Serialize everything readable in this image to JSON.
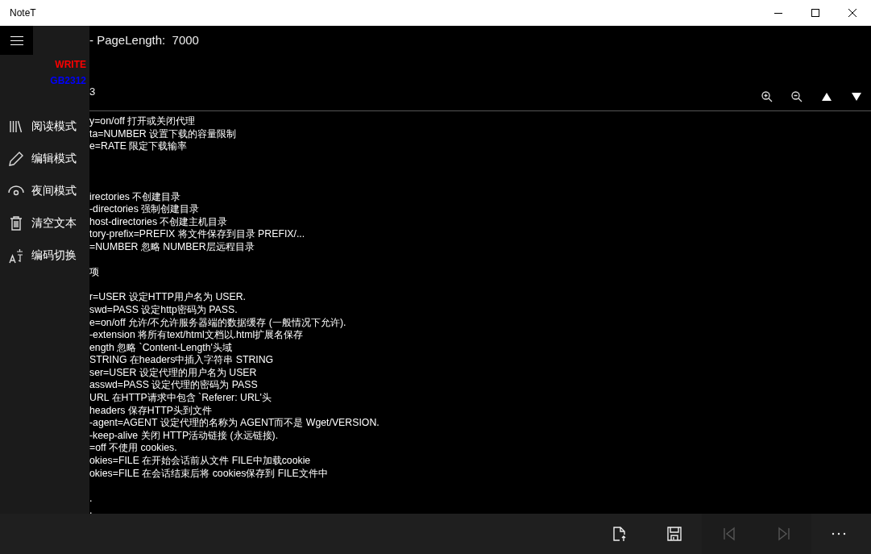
{
  "window": {
    "title": "NoteT"
  },
  "header": {
    "page_info": "- PageLength:  7000",
    "line_fragment": "3"
  },
  "sidebar": {
    "mode": "WRITE",
    "encoding": "GB2312",
    "items": [
      {
        "label": "阅读模式"
      },
      {
        "label": "编辑模式"
      },
      {
        "label": "夜间模式"
      },
      {
        "label": "清空文本"
      },
      {
        "label": "编码切换"
      }
    ]
  },
  "lines": [
    {
      "kind": "text",
      "text": "y=on/off 打开或关闭代理"
    },
    {
      "kind": "text",
      "text": "ta=NUMBER 设置下载的容量限制"
    },
    {
      "kind": "text",
      "text": "e=RATE 限定下载输率"
    },
    {
      "kind": "blank"
    },
    {
      "kind": "blank"
    },
    {
      "kind": "blank"
    },
    {
      "kind": "text",
      "text": "irectories 不创建目录"
    },
    {
      "kind": "text",
      "text": "-directories 强制创建目录"
    },
    {
      "kind": "text",
      "text": "host-directories 不创建主机目录"
    },
    {
      "kind": "text",
      "text": "tory-prefix=PREFIX 将文件保存到目录 PREFIX/..."
    },
    {
      "kind": "text",
      "text": "=NUMBER 忽略 NUMBER层远程目录"
    },
    {
      "kind": "blank"
    },
    {
      "kind": "text",
      "text": "项"
    },
    {
      "kind": "blank"
    },
    {
      "kind": "text",
      "text": "r=USER 设定HTTP用户名为 USER."
    },
    {
      "kind": "text",
      "text": "swd=PASS 设定http密码为 PASS."
    },
    {
      "kind": "text",
      "text": "e=on/off 允许/不允许服务器端的数据缓存 (一般情况下允许)."
    },
    {
      "kind": "text",
      "text": "-extension 将所有text/html文档以.html扩展名保存"
    },
    {
      "kind": "text",
      "text": "ength 忽略 `Content-Length'头域"
    },
    {
      "kind": "text",
      "text": "STRING 在headers中插入字符串 STRING"
    },
    {
      "kind": "text",
      "text": "ser=USER 设定代理的用户名为 USER"
    },
    {
      "kind": "text",
      "text": "asswd=PASS 设定代理的密码为 PASS"
    },
    {
      "kind": "text",
      "text": "URL 在HTTP请求中包含 `Referer: URL'头"
    },
    {
      "kind": "text",
      "text": "headers 保存HTTP头到文件"
    },
    {
      "kind": "text",
      "text": "-agent=AGENT 设定代理的名称为 AGENT而不是 Wget/VERSION."
    },
    {
      "kind": "text",
      "text": "-keep-alive 关闭 HTTP活动链接 (永远链接)."
    },
    {
      "kind": "text",
      "text": "=off 不使用 cookies."
    },
    {
      "kind": "text",
      "text": "okies=FILE 在开始会话前从文件 FILE中加载cookie"
    },
    {
      "kind": "text",
      "text": "okies=FILE 在会话结束后将 cookies保存到 FILE文件中"
    },
    {
      "kind": "blank"
    },
    {
      "kind": "text",
      "text": "."
    },
    {
      "kind": "text",
      "text": "."
    }
  ],
  "command_bar": [
    {
      "disabled": false
    },
    {
      "disabled": false
    },
    {
      "disabled": true
    },
    {
      "disabled": true
    },
    {
      "disabled": false
    }
  ]
}
